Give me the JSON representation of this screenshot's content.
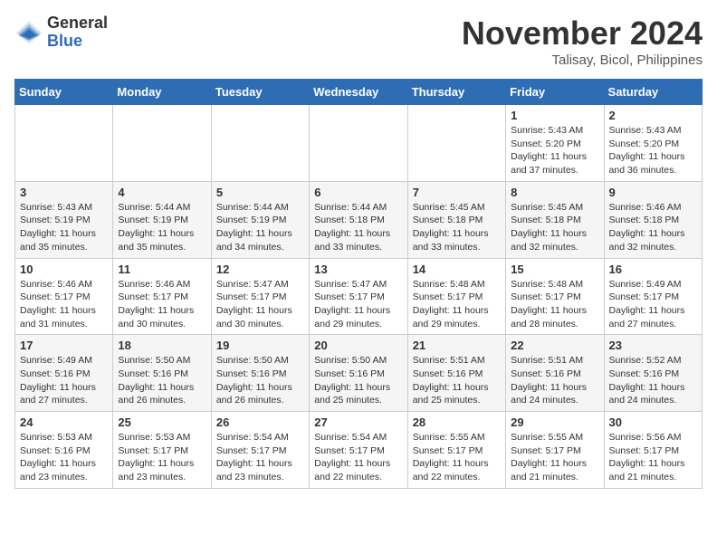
{
  "header": {
    "logo_general": "General",
    "logo_blue": "Blue",
    "month_title": "November 2024",
    "subtitle": "Talisay, Bicol, Philippines"
  },
  "weekdays": [
    "Sunday",
    "Monday",
    "Tuesday",
    "Wednesday",
    "Thursday",
    "Friday",
    "Saturday"
  ],
  "weeks": [
    [
      {
        "day": "",
        "info": ""
      },
      {
        "day": "",
        "info": ""
      },
      {
        "day": "",
        "info": ""
      },
      {
        "day": "",
        "info": ""
      },
      {
        "day": "",
        "info": ""
      },
      {
        "day": "1",
        "info": "Sunrise: 5:43 AM\nSunset: 5:20 PM\nDaylight: 11 hours\nand 37 minutes."
      },
      {
        "day": "2",
        "info": "Sunrise: 5:43 AM\nSunset: 5:20 PM\nDaylight: 11 hours\nand 36 minutes."
      }
    ],
    [
      {
        "day": "3",
        "info": "Sunrise: 5:43 AM\nSunset: 5:19 PM\nDaylight: 11 hours\nand 35 minutes."
      },
      {
        "day": "4",
        "info": "Sunrise: 5:44 AM\nSunset: 5:19 PM\nDaylight: 11 hours\nand 35 minutes."
      },
      {
        "day": "5",
        "info": "Sunrise: 5:44 AM\nSunset: 5:19 PM\nDaylight: 11 hours\nand 34 minutes."
      },
      {
        "day": "6",
        "info": "Sunrise: 5:44 AM\nSunset: 5:18 PM\nDaylight: 11 hours\nand 33 minutes."
      },
      {
        "day": "7",
        "info": "Sunrise: 5:45 AM\nSunset: 5:18 PM\nDaylight: 11 hours\nand 33 minutes."
      },
      {
        "day": "8",
        "info": "Sunrise: 5:45 AM\nSunset: 5:18 PM\nDaylight: 11 hours\nand 32 minutes."
      },
      {
        "day": "9",
        "info": "Sunrise: 5:46 AM\nSunset: 5:18 PM\nDaylight: 11 hours\nand 32 minutes."
      }
    ],
    [
      {
        "day": "10",
        "info": "Sunrise: 5:46 AM\nSunset: 5:17 PM\nDaylight: 11 hours\nand 31 minutes."
      },
      {
        "day": "11",
        "info": "Sunrise: 5:46 AM\nSunset: 5:17 PM\nDaylight: 11 hours\nand 30 minutes."
      },
      {
        "day": "12",
        "info": "Sunrise: 5:47 AM\nSunset: 5:17 PM\nDaylight: 11 hours\nand 30 minutes."
      },
      {
        "day": "13",
        "info": "Sunrise: 5:47 AM\nSunset: 5:17 PM\nDaylight: 11 hours\nand 29 minutes."
      },
      {
        "day": "14",
        "info": "Sunrise: 5:48 AM\nSunset: 5:17 PM\nDaylight: 11 hours\nand 29 minutes."
      },
      {
        "day": "15",
        "info": "Sunrise: 5:48 AM\nSunset: 5:17 PM\nDaylight: 11 hours\nand 28 minutes."
      },
      {
        "day": "16",
        "info": "Sunrise: 5:49 AM\nSunset: 5:17 PM\nDaylight: 11 hours\nand 27 minutes."
      }
    ],
    [
      {
        "day": "17",
        "info": "Sunrise: 5:49 AM\nSunset: 5:16 PM\nDaylight: 11 hours\nand 27 minutes."
      },
      {
        "day": "18",
        "info": "Sunrise: 5:50 AM\nSunset: 5:16 PM\nDaylight: 11 hours\nand 26 minutes."
      },
      {
        "day": "19",
        "info": "Sunrise: 5:50 AM\nSunset: 5:16 PM\nDaylight: 11 hours\nand 26 minutes."
      },
      {
        "day": "20",
        "info": "Sunrise: 5:50 AM\nSunset: 5:16 PM\nDaylight: 11 hours\nand 25 minutes."
      },
      {
        "day": "21",
        "info": "Sunrise: 5:51 AM\nSunset: 5:16 PM\nDaylight: 11 hours\nand 25 minutes."
      },
      {
        "day": "22",
        "info": "Sunrise: 5:51 AM\nSunset: 5:16 PM\nDaylight: 11 hours\nand 24 minutes."
      },
      {
        "day": "23",
        "info": "Sunrise: 5:52 AM\nSunset: 5:16 PM\nDaylight: 11 hours\nand 24 minutes."
      }
    ],
    [
      {
        "day": "24",
        "info": "Sunrise: 5:53 AM\nSunset: 5:16 PM\nDaylight: 11 hours\nand 23 minutes."
      },
      {
        "day": "25",
        "info": "Sunrise: 5:53 AM\nSunset: 5:17 PM\nDaylight: 11 hours\nand 23 minutes."
      },
      {
        "day": "26",
        "info": "Sunrise: 5:54 AM\nSunset: 5:17 PM\nDaylight: 11 hours\nand 23 minutes."
      },
      {
        "day": "27",
        "info": "Sunrise: 5:54 AM\nSunset: 5:17 PM\nDaylight: 11 hours\nand 22 minutes."
      },
      {
        "day": "28",
        "info": "Sunrise: 5:55 AM\nSunset: 5:17 PM\nDaylight: 11 hours\nand 22 minutes."
      },
      {
        "day": "29",
        "info": "Sunrise: 5:55 AM\nSunset: 5:17 PM\nDaylight: 11 hours\nand 21 minutes."
      },
      {
        "day": "30",
        "info": "Sunrise: 5:56 AM\nSunset: 5:17 PM\nDaylight: 11 hours\nand 21 minutes."
      }
    ]
  ]
}
